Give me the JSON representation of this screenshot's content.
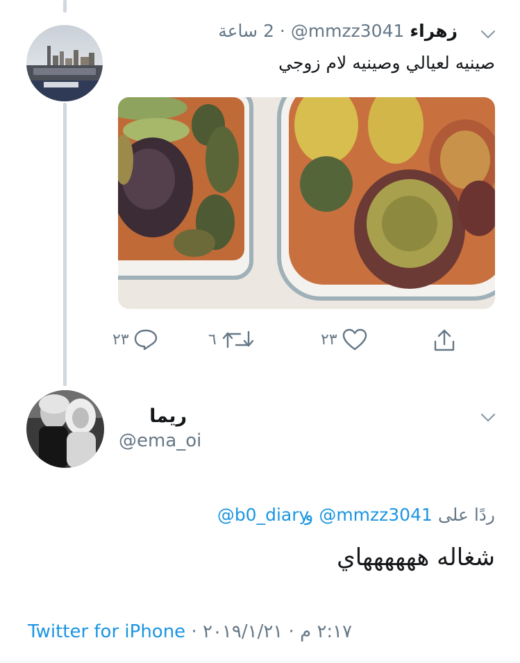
{
  "tweet": {
    "author_name": "زهراء",
    "handle": "@mmzz3041",
    "separator": "·",
    "time": "2 ساعة",
    "text": "صينيه لعيالي وصينيه لام زوجي",
    "actions": {
      "reply_count": "٢٣",
      "retweet_count": "٦",
      "like_count": "٢٣"
    }
  },
  "reply": {
    "author_name": "ريما",
    "handle": "@ema_oi",
    "replying_prefix": "ردًا على",
    "mention1": "@mmzz3041",
    "conjunction": "و",
    "mention2": "@b0_diary",
    "text": "شغاله ههههههاي",
    "source": "Twitter for iPhone",
    "dot": "·",
    "date": "٢٠١٩/١/٢١",
    "time": "٢:١٧ م"
  },
  "colors": {
    "link": "#1b95e0",
    "muted": "#657786",
    "thread_line": "#d0d7de"
  },
  "icons": [
    "chevron-down-icon",
    "reply-icon",
    "retweet-icon",
    "like-icon",
    "share-icon"
  ]
}
